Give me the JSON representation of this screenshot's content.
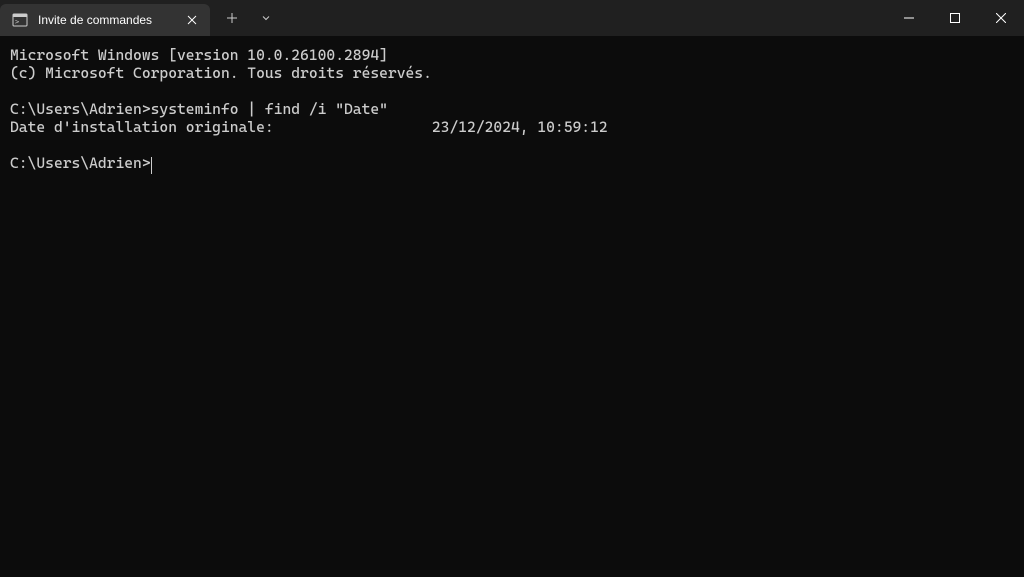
{
  "tab": {
    "title": "Invite de commandes"
  },
  "terminal": {
    "header1": "Microsoft Windows [version 10.0.26100.2894]",
    "header2": "(c) Microsoft Corporation. Tous droits réservés.",
    "prompt1": "C:\\Users\\Adrien>",
    "command1": "systeminfo | find /i \"Date\"",
    "output_label": "Date d'installation originale:",
    "output_value": "23/12/2024, 10:59:12",
    "prompt2": "C:\\Users\\Adrien>"
  }
}
